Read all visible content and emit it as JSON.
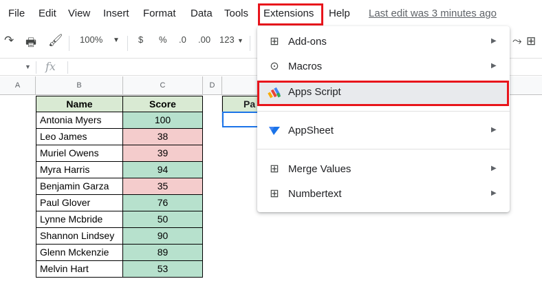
{
  "menubar": {
    "items": [
      {
        "label": "File",
        "name": "menu-file"
      },
      {
        "label": "Edit",
        "name": "menu-edit"
      },
      {
        "label": "View",
        "name": "menu-view"
      },
      {
        "label": "Insert",
        "name": "menu-insert"
      },
      {
        "label": "Format",
        "name": "menu-format"
      },
      {
        "label": "Data",
        "name": "menu-data"
      },
      {
        "label": "Tools",
        "name": "menu-tools"
      },
      {
        "label": "Extensions",
        "name": "menu-extensions"
      },
      {
        "label": "Help",
        "name": "menu-help"
      }
    ],
    "last_edit": "Last edit was 3 minutes ago"
  },
  "toolbar": {
    "zoom": "100%",
    "currency": "$",
    "percent": "%",
    "decrease_decimal": ".0",
    "increase_decimal": ".00",
    "more_formats": "123"
  },
  "formula_bar": {
    "fx": "fx",
    "value": ""
  },
  "columns": [
    "A",
    "B",
    "C",
    "D"
  ],
  "table": {
    "headers": {
      "name": "Name",
      "score": "Score"
    },
    "rows": [
      {
        "name": "Antonia Myers",
        "score": "100",
        "status": "high"
      },
      {
        "name": "Leo James",
        "score": "38",
        "status": "low"
      },
      {
        "name": "Muriel Owens",
        "score": "39",
        "status": "low"
      },
      {
        "name": "Myra Harris",
        "score": "94",
        "status": "high"
      },
      {
        "name": "Benjamin Garza",
        "score": "35",
        "status": "low"
      },
      {
        "name": "Paul Glover",
        "score": "76",
        "status": "high"
      },
      {
        "name": "Lynne Mcbride",
        "score": "50",
        "status": "high"
      },
      {
        "name": "Shannon Lindsey",
        "score": "90",
        "status": "high"
      },
      {
        "name": "Glenn Mckenzie",
        "score": "89",
        "status": "high"
      },
      {
        "name": "Melvin Hart",
        "score": "53",
        "status": "high"
      }
    ],
    "partial_header": "Pa"
  },
  "extensions_menu": {
    "items": [
      {
        "label": "Add-ons",
        "icon": "add-ons-icon",
        "submenu": true
      },
      {
        "label": "Macros",
        "icon": "macros-icon",
        "submenu": true
      },
      {
        "label": "Apps Script",
        "icon": "apps-script-icon",
        "submenu": false
      },
      {
        "label": "AppSheet",
        "icon": "appsheet-icon",
        "submenu": true
      },
      {
        "label": "Merge Values",
        "icon": "merge-values-icon",
        "submenu": true
      },
      {
        "label": "Numbertext",
        "icon": "numbertext-icon",
        "submenu": true
      }
    ]
  },
  "colors": {
    "highlight_red": "#e8141b",
    "score_high": "#b7e1cd",
    "score_low": "#f4cccc",
    "header_green": "#d9ead3",
    "selection_blue": "#1a73e8"
  }
}
